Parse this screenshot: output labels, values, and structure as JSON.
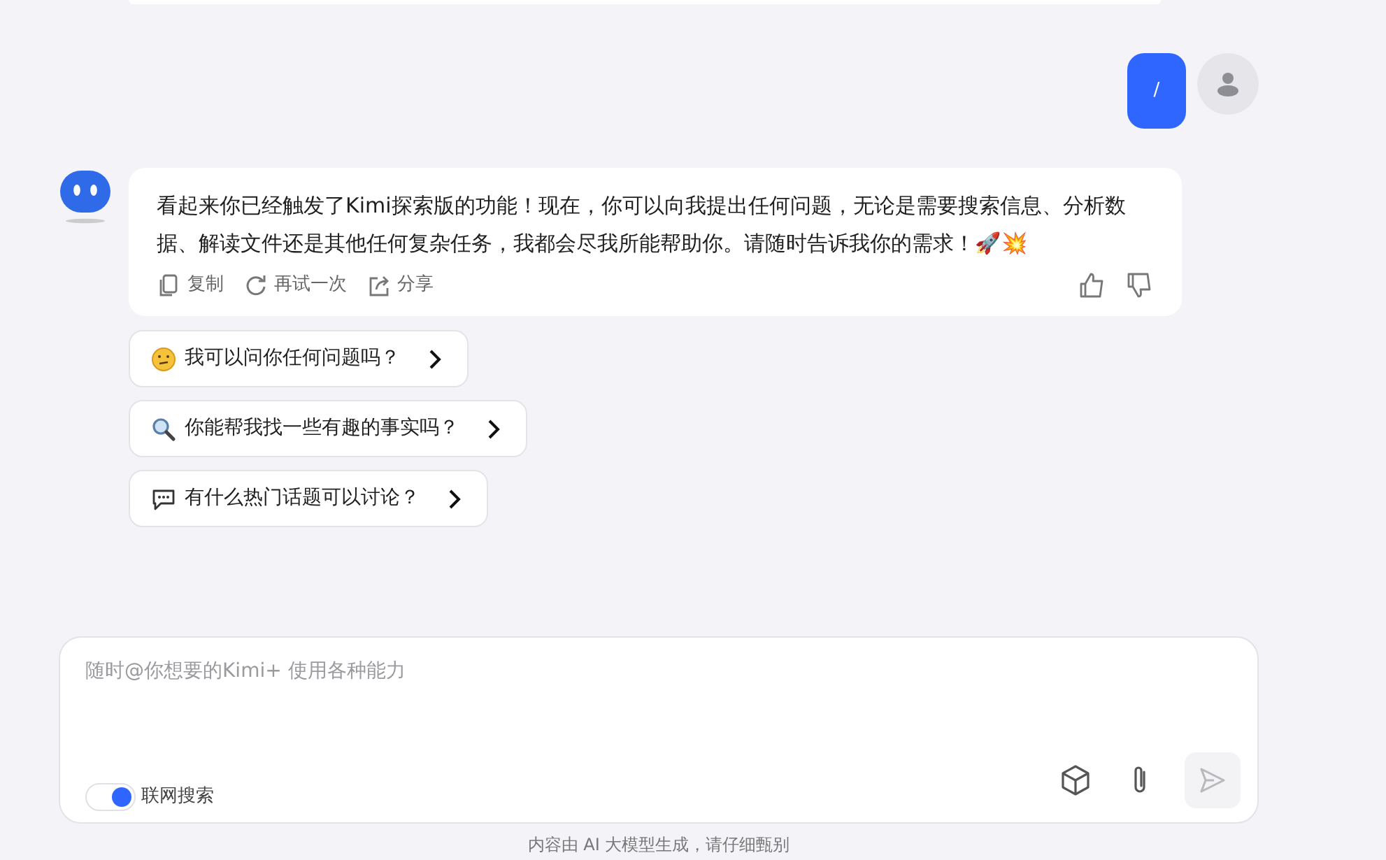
{
  "user_message": {
    "text": "/"
  },
  "assistant_message": {
    "text": "看起来你已经触发了Kimi探索版的功能！现在，你可以向我提出任何问题，无论是需要搜索信息、分析数据、解读文件还是其他任何复杂任务，我都会尽我所能帮助你。请随时告诉我你的需求！🚀💥",
    "actions": [
      {
        "kind": "copy",
        "label": "复制"
      },
      {
        "kind": "retry",
        "label": "再试一次"
      },
      {
        "kind": "share",
        "label": "分享"
      }
    ]
  },
  "suggestions": [
    {
      "kind": "thinking",
      "text": "我可以问你任何问题吗？"
    },
    {
      "kind": "search",
      "text": "你能帮我找一些有趣的事实吗？"
    },
    {
      "kind": "chat",
      "text": "有什么热门话题可以讨论？"
    }
  ],
  "composer": {
    "placeholder": "随时@你想要的Kimi+ 使用各种能力",
    "web_search": {
      "label": "联网搜索",
      "on": true
    },
    "send_disabled": true
  },
  "footer": "内容由 AI 大模型生成，请仔细甄别"
}
